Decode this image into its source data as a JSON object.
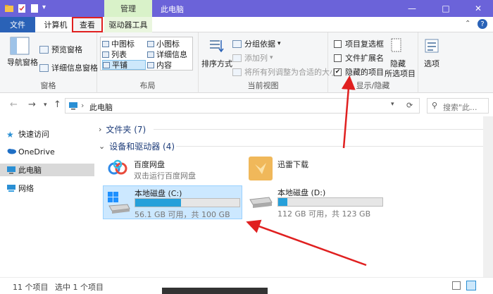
{
  "window": {
    "title": "此电脑",
    "manage_tab": "管理",
    "controls": {
      "minimize": "—",
      "maximize": "□",
      "close": "✕"
    }
  },
  "tabs": {
    "file": "文件",
    "computer": "计算机",
    "view": "查看",
    "drive_tools": "驱动器工具"
  },
  "ribbon": {
    "panes": {
      "label": "窗格",
      "navigation_pane": "导航窗格",
      "preview_pane": "预览窗格",
      "details_pane": "详细信息窗格"
    },
    "layout": {
      "label": "布局",
      "items": [
        "中图标",
        "小图标",
        "列表",
        "详细信息",
        "平铺",
        "内容"
      ],
      "selected": "平铺"
    },
    "current_view": {
      "label": "当前视图",
      "sort_by": "排序方式",
      "group_by": "分组依据",
      "add_columns": "添加列",
      "size_columns": "将所有列调整为合适的大小"
    },
    "show_hide": {
      "label": "显示/隐藏",
      "item_checkboxes": "项目复选框",
      "file_extensions": "文件扩展名",
      "hidden_items": "隐藏的项目",
      "hide_selected": "隐藏",
      "hide_selected_2": "所选项目",
      "options": "选项"
    }
  },
  "address": {
    "breadcrumb": "此电脑",
    "search_placeholder": "搜索\"此..."
  },
  "sidebar": {
    "items": [
      "快速访问",
      "OneDrive",
      "此电脑",
      "网络"
    ],
    "selected": "此电脑"
  },
  "content": {
    "folders_header": "文件夹 (7)",
    "devices_header": "设备和驱动器 (4)",
    "devices": [
      {
        "name": "百度网盘",
        "sub": "双击运行百度网盘"
      },
      {
        "name": "迅雷下载",
        "sub": ""
      },
      {
        "name": "本地磁盘 (C:)",
        "sub": "56.1 GB 可用，共 100 GB",
        "used_fraction": 0.44
      },
      {
        "name": "本地磁盘 (D:)",
        "sub": "112 GB 可用，共 123 GB",
        "used_fraction": 0.09
      }
    ]
  },
  "status": {
    "count": "11 个项目",
    "selected": "选中 1 个项目"
  },
  "colors": {
    "titlebar": "#6b63d9",
    "file_tab": "#2a62b7",
    "manage_tab": "#d9f2c9",
    "highlight_box": "#e02020",
    "annotation_arrow": "#e02020",
    "progress": "#26a0da"
  }
}
